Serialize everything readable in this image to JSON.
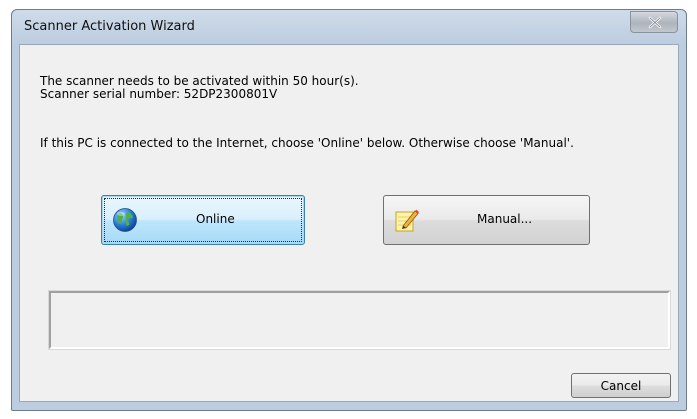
{
  "window": {
    "title": "Scanner Activation Wizard"
  },
  "message": {
    "line1": "The scanner needs to be activated within 50 hour(s).",
    "line2": "Scanner serial number: 52DP2300801V",
    "line3": "If this PC is connected to the Internet, choose 'Online' below. Otherwise choose 'Manual'."
  },
  "buttons": {
    "online": {
      "label": "Online",
      "icon": "globe-icon"
    },
    "manual": {
      "label": "Manual...",
      "icon": "pencil-notepad-icon"
    },
    "cancel": {
      "label": "Cancel"
    }
  },
  "status": {
    "text": ""
  },
  "colors": {
    "title_bar": "#bccde0",
    "client_bg": "#f0f0f0",
    "focus_button": "#bee6fd"
  }
}
